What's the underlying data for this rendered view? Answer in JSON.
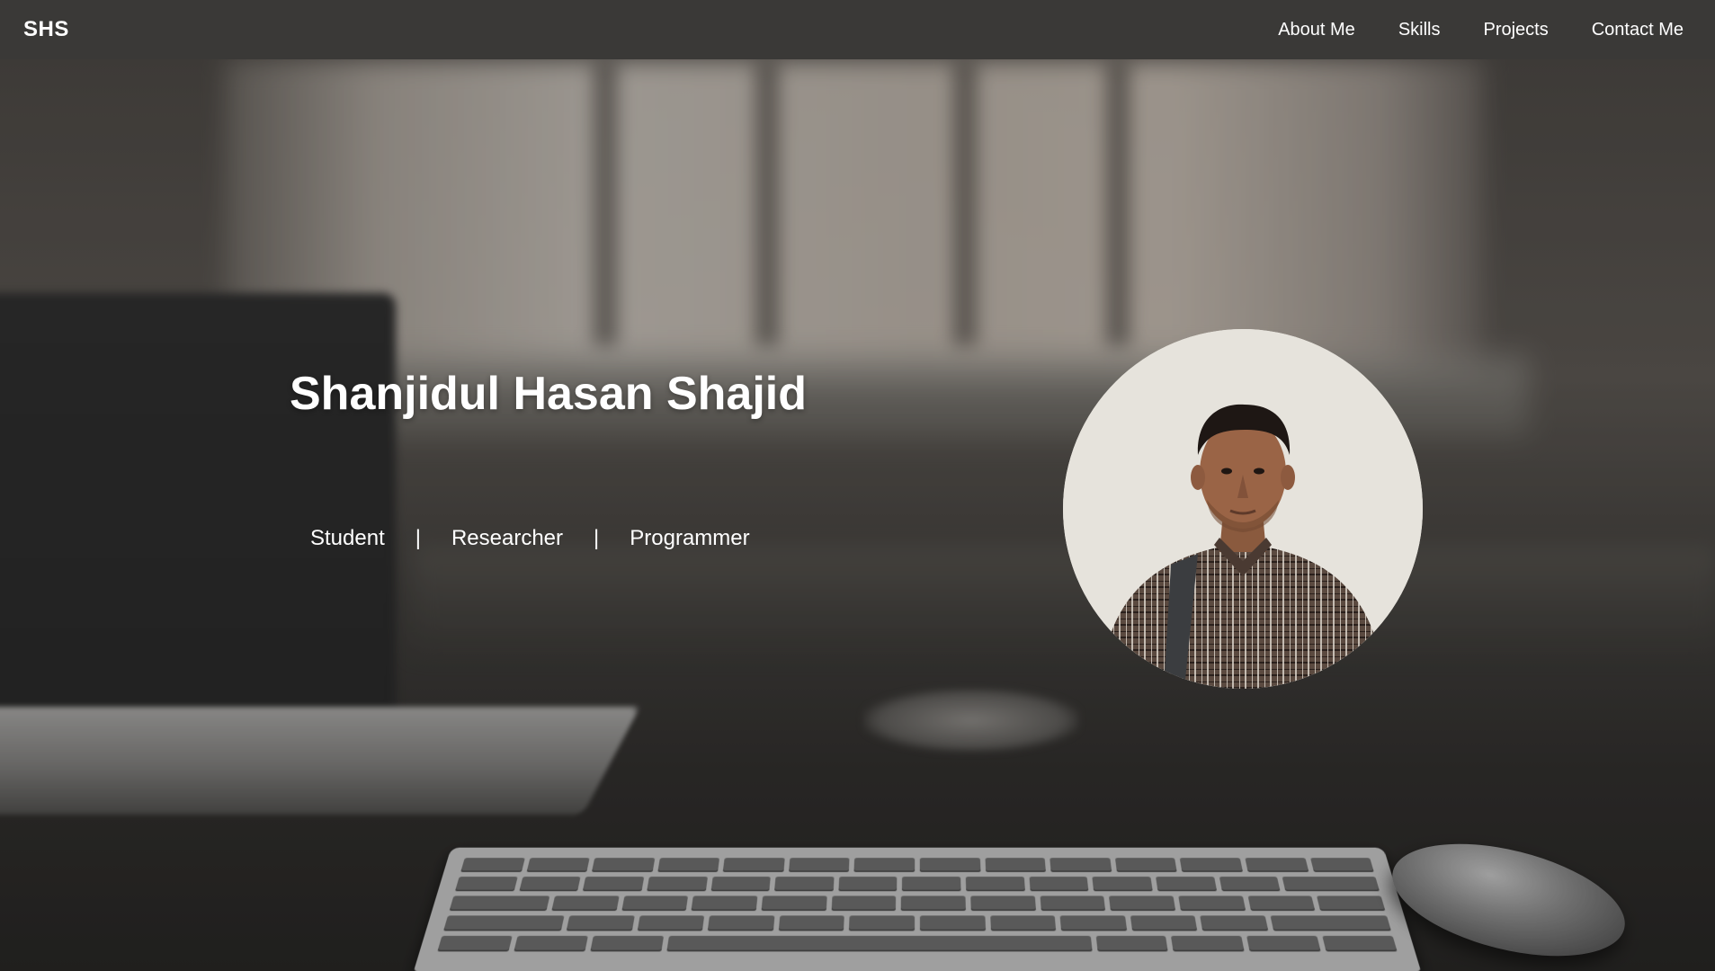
{
  "navbar": {
    "brand": "SHS",
    "links": [
      {
        "label": "About Me"
      },
      {
        "label": "Skills"
      },
      {
        "label": "Projects"
      },
      {
        "label": "Contact Me"
      }
    ]
  },
  "hero": {
    "name": "Shanjidul Hasan Shajid",
    "roles": [
      "Student",
      "Researcher",
      "Programmer"
    ],
    "separator": "|"
  },
  "colors": {
    "navbar_bg": "#3a3937",
    "text": "#ffffff"
  },
  "icons": {
    "avatar": "profile-photo"
  }
}
